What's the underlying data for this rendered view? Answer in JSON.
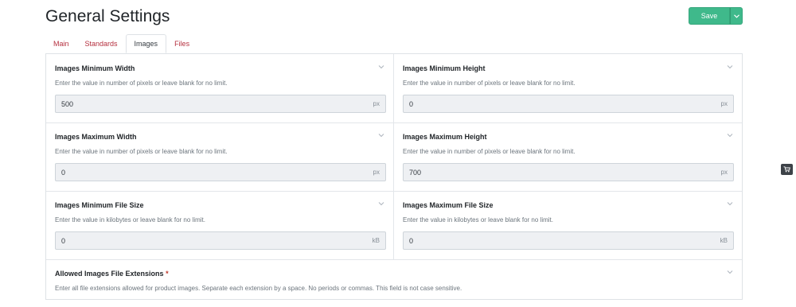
{
  "header": {
    "title": "General Settings",
    "save_label": "Save"
  },
  "tabs": [
    {
      "label": "Main",
      "active": false
    },
    {
      "label": "Standards",
      "active": false
    },
    {
      "label": "Images",
      "active": true
    },
    {
      "label": "Files",
      "active": false
    }
  ],
  "fields": {
    "min_width": {
      "label": "Images Minimum Width",
      "help": "Enter the value in number of pixels or leave blank for no limit.",
      "value": "500",
      "unit": "px"
    },
    "min_height": {
      "label": "Images Minimum Height",
      "help": "Enter the value in number of pixels or leave blank for no limit.",
      "value": "0",
      "unit": "px"
    },
    "max_width": {
      "label": "Images Maximum Width",
      "help": "Enter the value in number of pixels or leave blank for no limit.",
      "value": "0",
      "unit": "px"
    },
    "max_height": {
      "label": "Images Maximum Height",
      "help": "Enter the value in number of pixels or leave blank for no limit.",
      "value": "700",
      "unit": "px"
    },
    "min_size": {
      "label": "Images Minimum File Size",
      "help": "Enter the value in kilobytes or leave blank for no limit.",
      "value": "0",
      "unit": "kB"
    },
    "max_size": {
      "label": "Images Maximum File Size",
      "help": "Enter the value in kilobytes or leave blank for no limit.",
      "value": "0",
      "unit": "kB"
    },
    "extensions": {
      "label": "Allowed Images File Extensions",
      "required_mark": "*",
      "help": "Enter all file extensions allowed for product images. Separate each extension by a space. No periods or commas. This field is not case sensitive."
    }
  },
  "colors": {
    "accent": "#3fb98b",
    "tab_link": "#b5303f",
    "required": "#c0392b"
  },
  "icons": {
    "caret": "chevron-down-icon",
    "cart": "shopping-cart-icon"
  }
}
